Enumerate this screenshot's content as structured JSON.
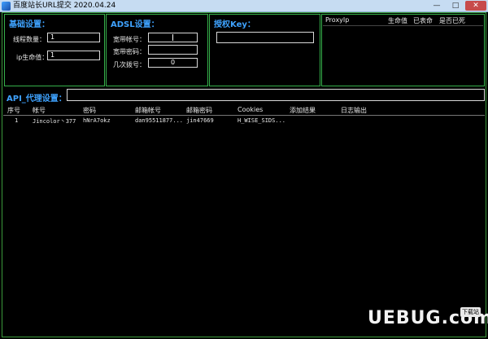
{
  "window": {
    "title": "百度站长URL提交 2020.04.24",
    "minimize": "—",
    "maximize": "□",
    "close": "✕"
  },
  "basic": {
    "title": "基础设置：",
    "threads_label": "线程数量：",
    "threads_value": "1",
    "ip_life_label": "ip生命值：",
    "ip_life_value": "1"
  },
  "adsl": {
    "title": "ADSL设置：",
    "account_label": "宽带帐号：",
    "account_value": "",
    "password_label": "宽带密码：",
    "password_value": "",
    "redial_label": "几次拨号：",
    "redial_value": "0"
  },
  "auth": {
    "title": "授权Key：",
    "key_value": ""
  },
  "proxy_list": {
    "columns": [
      "ProxyIp",
      "生命值",
      "已表命",
      "是否已死"
    ]
  },
  "api": {
    "label": "API_代理设置：",
    "value": ""
  },
  "table": {
    "columns": [
      "序号",
      "帐号",
      "密码",
      "邮箱帐号",
      "邮箱密码",
      "Cookies",
      "添加结果",
      "日志输出"
    ],
    "rows": [
      [
        "1",
        "Jincolor丶377",
        "hNrA7okz",
        "dan95511877...",
        "jin47669",
        "H_WISE_SIDS...",
        "",
        ""
      ]
    ]
  },
  "watermark": {
    "text": "UEBUG.com",
    "badge": "下载站"
  }
}
